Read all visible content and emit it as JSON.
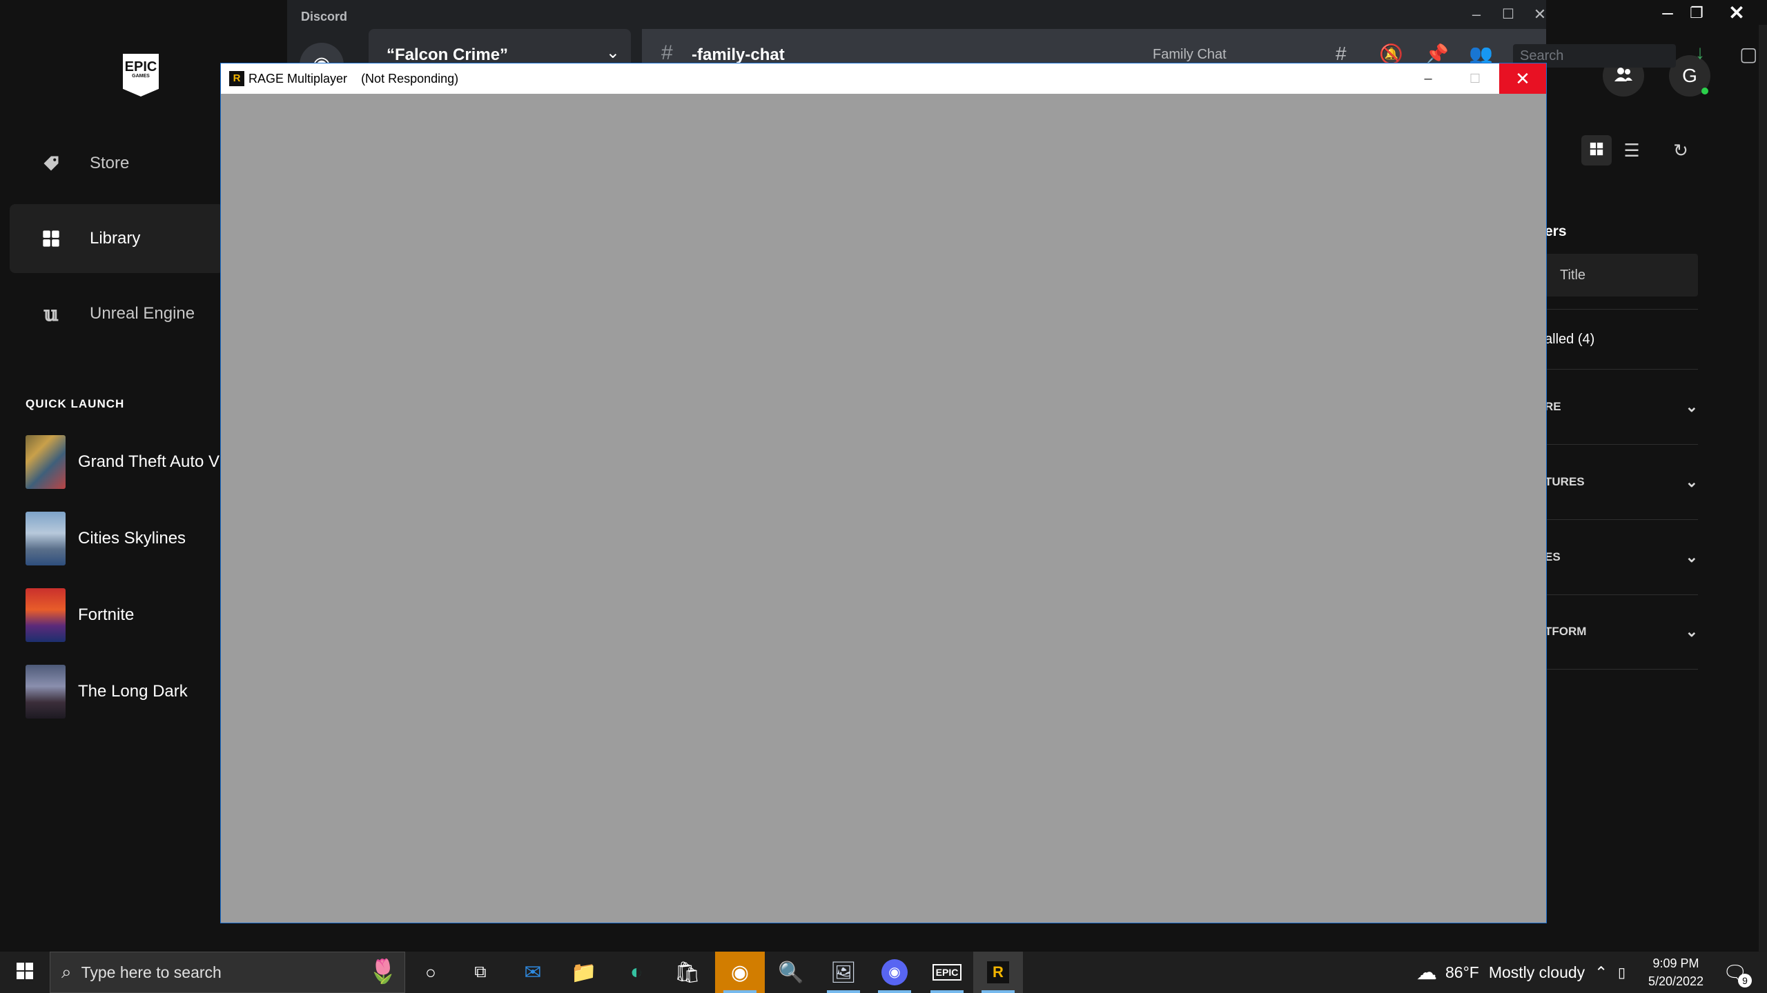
{
  "epic": {
    "logo": "EPIC",
    "logo_sub": "GAMES",
    "nav": [
      {
        "label": "Store",
        "icon": "tag-icon"
      },
      {
        "label": "Library",
        "icon": "grid-icon"
      },
      {
        "label": "Unreal Engine",
        "icon": "unreal-icon"
      }
    ],
    "quick_launch_title": "QUICK LAUNCH",
    "quick_launch": [
      {
        "label": "Grand Theft Auto V"
      },
      {
        "label": "Cities Skylines"
      },
      {
        "label": "Fortnite"
      },
      {
        "label": "The Long Dark"
      }
    ],
    "avatar_letter": "G",
    "filters_heading_partial": "ers",
    "sort_value": "Title",
    "installed_partial": "alled (4)",
    "filter_rows": [
      "RE",
      "TURES",
      "ES",
      "TFORM"
    ]
  },
  "discord": {
    "title": "Discord",
    "server_name": "“Falcon Crime”",
    "channel_name": "-family-chat",
    "channel_topic": "Family Chat",
    "search_placeholder": "Search"
  },
  "rage": {
    "title": "RAGE Multiplayer",
    "status": "(Not Responding)",
    "icon_letter": "R"
  },
  "taskbar": {
    "search_placeholder": "Type here to search",
    "weather_temp": "86°F",
    "weather_desc": "Mostly cloudy",
    "time": "9:09 PM",
    "date": "5/20/2022",
    "notification_count": "9",
    "epic_label": "EPIC"
  }
}
